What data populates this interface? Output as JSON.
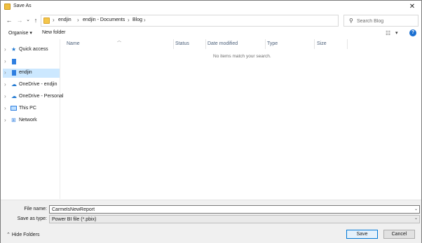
{
  "window": {
    "title": "Save As"
  },
  "address": {
    "crumbs": [
      "endjin",
      "endjin - Documents",
      "Blog"
    ],
    "search_placeholder": "Search Blog"
  },
  "toolbar": {
    "organise_label": "Organise",
    "new_folder_label": "New folder"
  },
  "nav": {
    "items": [
      {
        "label": "Quick access",
        "icon": "star-icon"
      },
      {
        "label": "",
        "icon": "document-icon"
      },
      {
        "label": "endjin",
        "icon": "document-icon",
        "selected": true
      },
      {
        "label": "OneDrive - endjin",
        "icon": "cloud-icon"
      },
      {
        "label": "OneDrive - Personal",
        "icon": "cloud-icon"
      },
      {
        "label": "This PC",
        "icon": "computer-icon"
      },
      {
        "label": "Network",
        "icon": "network-icon"
      }
    ]
  },
  "files": {
    "columns": [
      "Name",
      "Status",
      "Date modified",
      "Type",
      "Size"
    ],
    "empty_message": "No items match your search."
  },
  "form": {
    "filename_label": "File name:",
    "filename_value": "CarmelsNewReport",
    "type_label": "Save as type:",
    "type_value": "Power BI file (*.pbix)"
  },
  "footer": {
    "hide_folders_label": "Hide Folders",
    "save_label": "Save",
    "cancel_label": "Cancel"
  },
  "colors": {
    "accent": "#0078d7",
    "selected_bg": "#cce8ff",
    "help": "#1a6fd1"
  }
}
